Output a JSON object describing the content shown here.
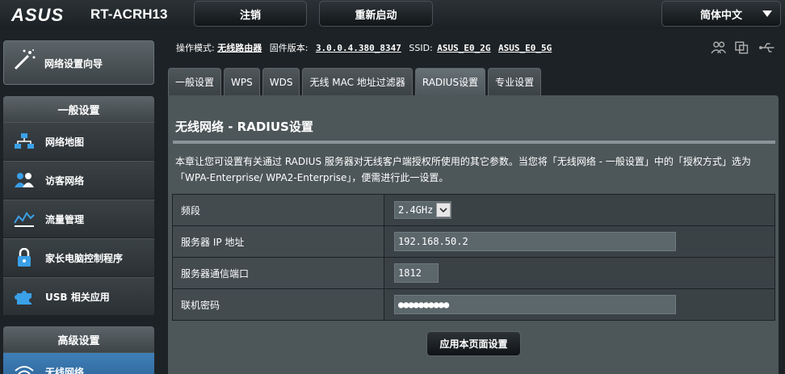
{
  "header": {
    "brand": "ASUS",
    "model": "RT-ACRH13",
    "logout_label": "注销",
    "reboot_label": "重新启动",
    "language": "简体中文"
  },
  "sidebar": {
    "wizard_label": "网络设置向导",
    "general_heading": "一般设置",
    "general_items": [
      {
        "label": "网络地图",
        "icon": "network-map-icon"
      },
      {
        "label": "访客网络",
        "icon": "guest-network-icon"
      },
      {
        "label": "流量管理",
        "icon": "traffic-manager-icon"
      },
      {
        "label": "家长电脑控制程序",
        "icon": "parental-control-icon"
      },
      {
        "label": "USB 相关应用",
        "icon": "usb-app-icon"
      }
    ],
    "advanced_heading": "高级设置",
    "advanced_items": [
      {
        "label": "无线网络",
        "icon": "wireless-icon"
      }
    ]
  },
  "status": {
    "mode_label": "操作模式:",
    "mode_value": "无线路由器",
    "firmware_label": "固件版本:",
    "firmware_value": "3.0.0.4.380_8347",
    "ssid_label": "SSID:",
    "ssid_1": "ASUS_E0_2G",
    "ssid_2": "ASUS_E0_5G"
  },
  "tabs": [
    "一般设置",
    "WPS",
    "WDS",
    "无线 MAC 地址过滤器",
    "RADIUS设置",
    "专业设置"
  ],
  "active_tab": "RADIUS设置",
  "main": {
    "title": "无线网络 - RADIUS设置",
    "description": "本章让您可设置有关通过 RADIUS 服务器对无线客户端授权所使用的其它参数。当您将「无线网络 - 一般设置」中的「授权方式」选为「WPA-Enterprise/ WPA2-Enterprise」，便需进行此一设置。",
    "fields": {
      "band_label": "频段",
      "band_value": "2.4GHz",
      "server_ip_label": "服务器 IP 地址",
      "server_ip_value": "192.168.50.2",
      "server_port_label": "服务器通信端口",
      "server_port_value": "1812",
      "secret_label": "联机密码",
      "secret_value": "●●●●●●●●●●"
    },
    "apply_label": "应用本页面设置"
  }
}
